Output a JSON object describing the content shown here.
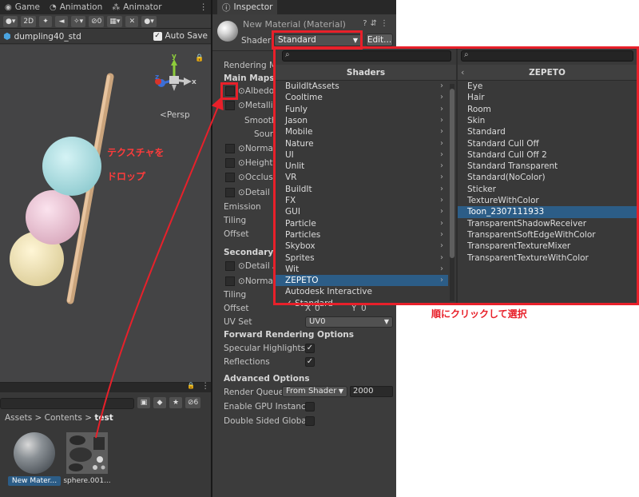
{
  "scene": {
    "tabs": [
      {
        "label": "Game",
        "icon": "game-controller-icon"
      },
      {
        "label": "Animation",
        "icon": "animation-icon"
      },
      {
        "label": "Animator",
        "icon": "animator-icon"
      }
    ],
    "toolbar_2d": "2D",
    "toolbar_hidden_count": "0",
    "prefab_name": "dumpling40_std",
    "auto_save_label": "Auto Save",
    "gizmo_x": "x",
    "gizmo_y": "y",
    "gizmo_z": "z",
    "persp_label": "Persp"
  },
  "project": {
    "hidden_count": "6",
    "breadcrumb": [
      "Assets",
      "Contents",
      "test"
    ],
    "assets": [
      {
        "label": "New Mater...",
        "selected": true
      },
      {
        "label": "sphere.001...",
        "selected": false
      }
    ]
  },
  "inspector": {
    "tab_label": "Inspector",
    "material_title": "New Material (Material)",
    "shader_label": "Shader",
    "shader_value": "Standard",
    "edit_label": "Edit...",
    "rendering_mode": "Rendering Mo",
    "main_maps": "Main Maps",
    "albedo": "Albedo",
    "metallic": "Metallic",
    "smooth": "Smooth",
    "source": "Sourc",
    "normal": "Normal",
    "height": "Height M",
    "occlusion": "Occlusio",
    "detail_mask": "Detail M",
    "emission": "Emission",
    "tiling": "Tiling",
    "offset": "Offset",
    "secondary_maps": "Secondary M",
    "detail_albedo": "Detail A",
    "normal2": "Normal",
    "tiling2": "Tiling",
    "offset2": "Offset",
    "offset2_x_label": "X",
    "offset2_x": "0",
    "offset2_y_label": "Y",
    "offset2_y": "0",
    "uv_set_label": "UV Set",
    "uv_set_value": "UV0",
    "forward_rendering": "Forward Rendering Options",
    "specular_highlights": "Specular Highlights",
    "reflections": "Reflections",
    "advanced_options": "Advanced Options",
    "render_queue_label": "Render Queue",
    "render_queue_mode": "From Shader",
    "render_queue_value": "2000",
    "enable_gpu": "Enable GPU Instancin",
    "double_sided": "Double Sided Global I"
  },
  "shader_popup": {
    "left_header": "Shaders",
    "left_items": [
      "BuildItAssets",
      "Cooltime",
      "Funly",
      "Jason",
      "Mobile",
      "Nature",
      "UI",
      "Unlit",
      "VR",
      "BuildIt",
      "FX",
      "GUI",
      "Particle",
      "Particles",
      "Skybox",
      "Sprites",
      "Wit",
      "ZEPETO",
      "Autodesk Interactive",
      "✓ Standard"
    ],
    "left_has_submenu": [
      true,
      true,
      true,
      true,
      true,
      true,
      true,
      true,
      true,
      true,
      true,
      true,
      true,
      true,
      true,
      true,
      true,
      true,
      false,
      false
    ],
    "left_selected_index": 17,
    "right_header": "ZEPETO",
    "right_items": [
      "Eye",
      "Hair",
      "Room",
      "Skin",
      "Standard",
      "Standard Cull Off",
      "Standard Cull Off 2",
      "Standard Transparent",
      "Standard(NoColor)",
      "Sticker",
      "TextureWithColor",
      "Toon_2307111933",
      "TransparentShadowReceiver",
      "TransparentSoftEdgeWithColor",
      "TransparentTextureMixer",
      "TransparentTextureWithColor"
    ],
    "right_selected_index": 11
  },
  "annotations": {
    "drop_texture": "テクスチャを",
    "drop_texture2": "ドロップ",
    "click_in_order": "順にクリックして選択",
    "color": "#e8202a"
  }
}
